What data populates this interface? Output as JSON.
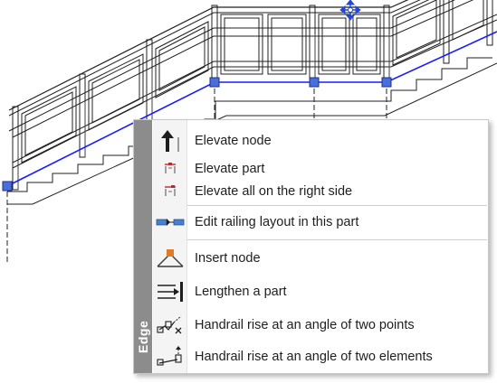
{
  "context_menu": {
    "strip_label": "Edge",
    "items": [
      {
        "label": "Elevate node",
        "icon": "elevate-node-icon"
      },
      {
        "label": "Elevate part",
        "icon": "elevate-part-icon"
      },
      {
        "label": "Elevate all on the right side",
        "icon": "elevate-all-right-icon"
      },
      {
        "label": "Edit railing layout in this part",
        "icon": "edit-railing-layout-icon"
      },
      {
        "label": "Insert node",
        "icon": "insert-node-icon"
      },
      {
        "label": "Lengthen a part",
        "icon": "lengthen-part-icon"
      },
      {
        "label": "Handrail rise at an angle of two points",
        "icon": "handrail-two-points-icon"
      },
      {
        "label": "Handrail rise at an angle of two elements",
        "icon": "handrail-two-elements-icon"
      }
    ]
  },
  "colors": {
    "edge_line": "#1a1aff",
    "node_fill": "#4a6fd8",
    "menu_strip": "#8c8c8c",
    "icon_orange": "#e07b2a",
    "icon_red": "#c0282d"
  }
}
